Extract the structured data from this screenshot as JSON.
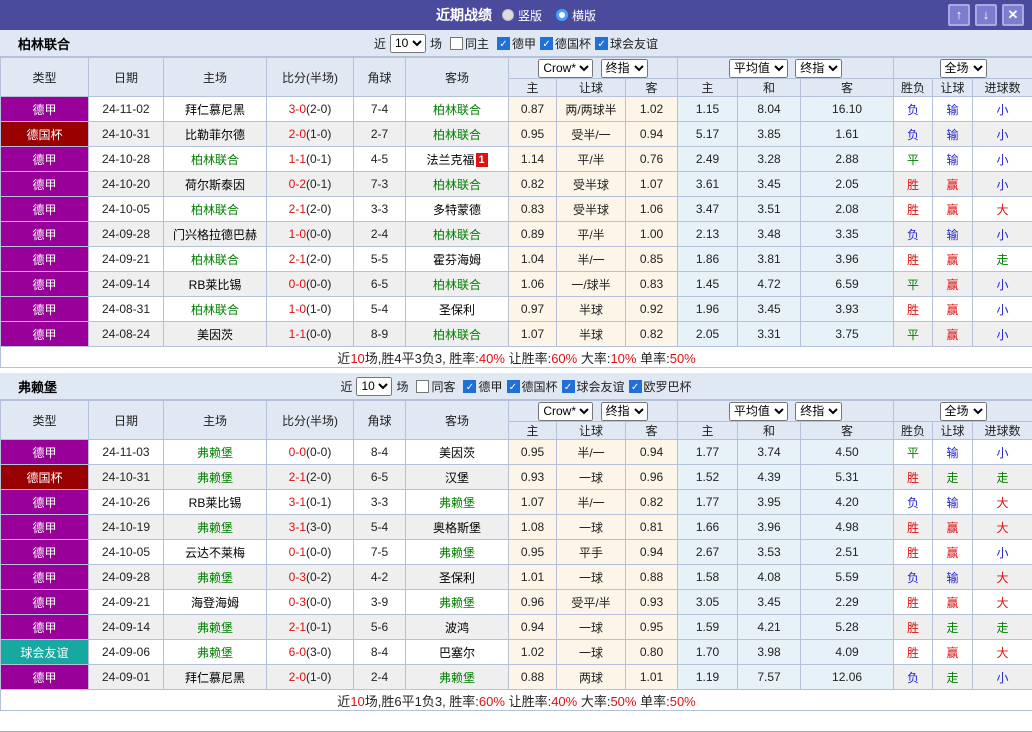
{
  "titlebar": {
    "title": "近期战绩",
    "radios": [
      {
        "label": "竖版",
        "selected": false
      },
      {
        "label": "横版",
        "selected": true
      }
    ],
    "buttons": {
      "up": "↑",
      "down": "↓",
      "close": "✕"
    }
  },
  "table_header": {
    "type": "类型",
    "date": "日期",
    "home": "主场",
    "score": "比分(半场)",
    "corner": "角球",
    "away": "客场",
    "odds_source": "Crow*",
    "odds_time": "终指",
    "avg_source": "平均值",
    "avg_time": "终指",
    "scope": "全场",
    "sub": [
      "主",
      "让球",
      "客",
      "主",
      "和",
      "客",
      "胜负",
      "让球",
      "进球数"
    ]
  },
  "colors": {
    "titlebar_bg": "#4b4b9d",
    "header_bg": "#dfe8f3",
    "border": "#b4c1d8",
    "bundesliga": "#990099",
    "dfb_pokal": "#990000",
    "friendly": "#17a99f",
    "team_green": "#008000",
    "score_red": "#dd1111",
    "result_red": "#dd1111",
    "result_blue": "#2323cb",
    "result_green": "#008000",
    "odds_bg": "#fdf5e8",
    "avg_bg": "#e6f2f8",
    "row_alt_bg": "#efefef"
  },
  "sections": [
    {
      "team": "柏林联合",
      "filter": {
        "near_label": "近",
        "count": "10",
        "matches_label": "场",
        "same": {
          "label": "同主",
          "checked": false
        },
        "comps": [
          {
            "label": "德甲",
            "checked": true
          },
          {
            "label": "德国杯",
            "checked": true
          },
          {
            "label": "球会友谊",
            "checked": true
          }
        ]
      },
      "rows": [
        {
          "comp": "德甲",
          "date": "24-11-02",
          "home": "拜仁慕尼黑",
          "home_green": false,
          "score_ft": "3-0",
          "score_ht": "(2-0)",
          "corner": "7-4",
          "away": "柏林联合",
          "away_green": true,
          "badge": "",
          "odds": [
            "0.87",
            "两/两球半",
            "1.02"
          ],
          "avg": [
            "1.15",
            "8.04",
            "16.10"
          ],
          "results": [
            {
              "t": "负",
              "c": "blue"
            },
            {
              "t": "输",
              "c": "blue"
            },
            {
              "t": "小",
              "c": "blue"
            }
          ]
        },
        {
          "comp": "德国杯",
          "date": "24-10-31",
          "home": "比勒菲尔德",
          "home_green": false,
          "score_ft": "2-0",
          "score_ht": "(1-0)",
          "corner": "2-7",
          "away": "柏林联合",
          "away_green": true,
          "badge": "",
          "odds": [
            "0.95",
            "受半/一",
            "0.94"
          ],
          "avg": [
            "5.17",
            "3.85",
            "1.61"
          ],
          "results": [
            {
              "t": "负",
              "c": "blue"
            },
            {
              "t": "输",
              "c": "blue"
            },
            {
              "t": "小",
              "c": "blue"
            }
          ]
        },
        {
          "comp": "德甲",
          "date": "24-10-28",
          "home": "柏林联合",
          "home_green": true,
          "score_ft": "1-1",
          "score_ht": "(0-1)",
          "corner": "4-5",
          "away": "法兰克福",
          "away_green": false,
          "badge": "1",
          "odds": [
            "1.14",
            "平/半",
            "0.76"
          ],
          "avg": [
            "2.49",
            "3.28",
            "2.88"
          ],
          "results": [
            {
              "t": "平",
              "c": "green"
            },
            {
              "t": "输",
              "c": "blue"
            },
            {
              "t": "小",
              "c": "blue"
            }
          ]
        },
        {
          "comp": "德甲",
          "date": "24-10-20",
          "home": "荷尔斯泰因",
          "home_green": false,
          "score_ft": "0-2",
          "score_ht": "(0-1)",
          "corner": "7-3",
          "away": "柏林联合",
          "away_green": true,
          "badge": "",
          "odds": [
            "0.82",
            "受半球",
            "1.07"
          ],
          "avg": [
            "3.61",
            "3.45",
            "2.05"
          ],
          "results": [
            {
              "t": "胜",
              "c": "red"
            },
            {
              "t": "赢",
              "c": "red"
            },
            {
              "t": "小",
              "c": "blue"
            }
          ]
        },
        {
          "comp": "德甲",
          "date": "24-10-05",
          "home": "柏林联合",
          "home_green": true,
          "score_ft": "2-1",
          "score_ht": "(2-0)",
          "corner": "3-3",
          "away": "多特蒙德",
          "away_green": false,
          "badge": "",
          "odds": [
            "0.83",
            "受半球",
            "1.06"
          ],
          "avg": [
            "3.47",
            "3.51",
            "2.08"
          ],
          "results": [
            {
              "t": "胜",
              "c": "red"
            },
            {
              "t": "赢",
              "c": "red"
            },
            {
              "t": "大",
              "c": "red"
            }
          ]
        },
        {
          "comp": "德甲",
          "date": "24-09-28",
          "home": "门兴格拉德巴赫",
          "home_green": false,
          "score_ft": "1-0",
          "score_ht": "(0-0)",
          "corner": "2-4",
          "away": "柏林联合",
          "away_green": true,
          "badge": "",
          "odds": [
            "0.89",
            "平/半",
            "1.00"
          ],
          "avg": [
            "2.13",
            "3.48",
            "3.35"
          ],
          "results": [
            {
              "t": "负",
              "c": "blue"
            },
            {
              "t": "输",
              "c": "blue"
            },
            {
              "t": "小",
              "c": "blue"
            }
          ]
        },
        {
          "comp": "德甲",
          "date": "24-09-21",
          "home": "柏林联合",
          "home_green": true,
          "score_ft": "2-1",
          "score_ht": "(2-0)",
          "corner": "5-5",
          "away": "霍芬海姆",
          "away_green": false,
          "badge": "",
          "odds": [
            "1.04",
            "半/一",
            "0.85"
          ],
          "avg": [
            "1.86",
            "3.81",
            "3.96"
          ],
          "results": [
            {
              "t": "胜",
              "c": "red"
            },
            {
              "t": "赢",
              "c": "red"
            },
            {
              "t": "走",
              "c": "green"
            }
          ]
        },
        {
          "comp": "德甲",
          "date": "24-09-14",
          "home": "RB莱比锡",
          "home_green": false,
          "score_ft": "0-0",
          "score_ht": "(0-0)",
          "corner": "6-5",
          "away": "柏林联合",
          "away_green": true,
          "badge": "",
          "odds": [
            "1.06",
            "一/球半",
            "0.83"
          ],
          "avg": [
            "1.45",
            "4.72",
            "6.59"
          ],
          "results": [
            {
              "t": "平",
              "c": "green"
            },
            {
              "t": "赢",
              "c": "red"
            },
            {
              "t": "小",
              "c": "blue"
            }
          ]
        },
        {
          "comp": "德甲",
          "date": "24-08-31",
          "home": "柏林联合",
          "home_green": true,
          "score_ft": "1-0",
          "score_ht": "(1-0)",
          "corner": "5-4",
          "away": "圣保利",
          "away_green": false,
          "badge": "",
          "odds": [
            "0.97",
            "半球",
            "0.92"
          ],
          "avg": [
            "1.96",
            "3.45",
            "3.93"
          ],
          "results": [
            {
              "t": "胜",
              "c": "red"
            },
            {
              "t": "赢",
              "c": "red"
            },
            {
              "t": "小",
              "c": "blue"
            }
          ]
        },
        {
          "comp": "德甲",
          "date": "24-08-24",
          "home": "美因茨",
          "home_green": false,
          "score_ft": "1-1",
          "score_ht": "(0-0)",
          "corner": "8-9",
          "away": "柏林联合",
          "away_green": true,
          "badge": "",
          "odds": [
            "1.07",
            "半球",
            "0.82"
          ],
          "avg": [
            "2.05",
            "3.31",
            "3.75"
          ],
          "results": [
            {
              "t": "平",
              "c": "green"
            },
            {
              "t": "赢",
              "c": "red"
            },
            {
              "t": "小",
              "c": "blue"
            }
          ]
        }
      ],
      "summary": [
        {
          "t": "近",
          "c": "k"
        },
        {
          "t": "10",
          "c": "red"
        },
        {
          "t": "场,胜4平3负3, 胜率:",
          "c": "k"
        },
        {
          "t": "40%",
          "c": "red"
        },
        {
          "t": " 让胜率:",
          "c": "k"
        },
        {
          "t": "60%",
          "c": "red"
        },
        {
          "t": " 大率:",
          "c": "k"
        },
        {
          "t": "10%",
          "c": "red"
        },
        {
          "t": " 单率:",
          "c": "k"
        },
        {
          "t": "50%",
          "c": "red"
        }
      ]
    },
    {
      "team": "弗赖堡",
      "filter": {
        "near_label": "近",
        "count": "10",
        "matches_label": "场",
        "same": {
          "label": "同客",
          "checked": false
        },
        "comps": [
          {
            "label": "德甲",
            "checked": true
          },
          {
            "label": "德国杯",
            "checked": true
          },
          {
            "label": "球会友谊",
            "checked": true
          },
          {
            "label": "欧罗巴杯",
            "checked": true
          }
        ]
      },
      "rows": [
        {
          "comp": "德甲",
          "date": "24-11-03",
          "home": "弗赖堡",
          "home_green": true,
          "score_ft": "0-0",
          "score_ht": "(0-0)",
          "corner": "8-4",
          "away": "美因茨",
          "away_green": false,
          "badge": "",
          "odds": [
            "0.95",
            "半/一",
            "0.94"
          ],
          "avg": [
            "1.77",
            "3.74",
            "4.50"
          ],
          "results": [
            {
              "t": "平",
              "c": "green"
            },
            {
              "t": "输",
              "c": "blue"
            },
            {
              "t": "小",
              "c": "blue"
            }
          ]
        },
        {
          "comp": "德国杯",
          "date": "24-10-31",
          "home": "弗赖堡",
          "home_green": true,
          "score_ft": "2-1",
          "score_ht": "(2-0)",
          "corner": "6-5",
          "away": "汉堡",
          "away_green": false,
          "badge": "",
          "odds": [
            "0.93",
            "一球",
            "0.96"
          ],
          "avg": [
            "1.52",
            "4.39",
            "5.31"
          ],
          "results": [
            {
              "t": "胜",
              "c": "red"
            },
            {
              "t": "走",
              "c": "green"
            },
            {
              "t": "走",
              "c": "green"
            }
          ]
        },
        {
          "comp": "德甲",
          "date": "24-10-26",
          "home": "RB莱比锡",
          "home_green": false,
          "score_ft": "3-1",
          "score_ht": "(0-1)",
          "corner": "3-3",
          "away": "弗赖堡",
          "away_green": true,
          "badge": "",
          "odds": [
            "1.07",
            "半/一",
            "0.82"
          ],
          "avg": [
            "1.77",
            "3.95",
            "4.20"
          ],
          "results": [
            {
              "t": "负",
              "c": "blue"
            },
            {
              "t": "输",
              "c": "blue"
            },
            {
              "t": "大",
              "c": "red"
            }
          ]
        },
        {
          "comp": "德甲",
          "date": "24-10-19",
          "home": "弗赖堡",
          "home_green": true,
          "score_ft": "3-1",
          "score_ht": "(3-0)",
          "corner": "5-4",
          "away": "奥格斯堡",
          "away_green": false,
          "badge": "",
          "odds": [
            "1.08",
            "一球",
            "0.81"
          ],
          "avg": [
            "1.66",
            "3.96",
            "4.98"
          ],
          "results": [
            {
              "t": "胜",
              "c": "red"
            },
            {
              "t": "赢",
              "c": "red"
            },
            {
              "t": "大",
              "c": "red"
            }
          ]
        },
        {
          "comp": "德甲",
          "date": "24-10-05",
          "home": "云达不莱梅",
          "home_green": false,
          "score_ft": "0-1",
          "score_ht": "(0-0)",
          "corner": "7-5",
          "away": "弗赖堡",
          "away_green": true,
          "badge": "",
          "odds": [
            "0.95",
            "平手",
            "0.94"
          ],
          "avg": [
            "2.67",
            "3.53",
            "2.51"
          ],
          "results": [
            {
              "t": "胜",
              "c": "red"
            },
            {
              "t": "赢",
              "c": "red"
            },
            {
              "t": "小",
              "c": "blue"
            }
          ]
        },
        {
          "comp": "德甲",
          "date": "24-09-28",
          "home": "弗赖堡",
          "home_green": true,
          "score_ft": "0-3",
          "score_ht": "(0-2)",
          "corner": "4-2",
          "away": "圣保利",
          "away_green": false,
          "badge": "",
          "odds": [
            "1.01",
            "一球",
            "0.88"
          ],
          "avg": [
            "1.58",
            "4.08",
            "5.59"
          ],
          "results": [
            {
              "t": "负",
              "c": "blue"
            },
            {
              "t": "输",
              "c": "blue"
            },
            {
              "t": "大",
              "c": "red"
            }
          ]
        },
        {
          "comp": "德甲",
          "date": "24-09-21",
          "home": "海登海姆",
          "home_green": false,
          "score_ft": "0-3",
          "score_ht": "(0-0)",
          "corner": "3-9",
          "away": "弗赖堡",
          "away_green": true,
          "badge": "",
          "odds": [
            "0.96",
            "受平/半",
            "0.93"
          ],
          "avg": [
            "3.05",
            "3.45",
            "2.29"
          ],
          "results": [
            {
              "t": "胜",
              "c": "red"
            },
            {
              "t": "赢",
              "c": "red"
            },
            {
              "t": "大",
              "c": "red"
            }
          ]
        },
        {
          "comp": "德甲",
          "date": "24-09-14",
          "home": "弗赖堡",
          "home_green": true,
          "score_ft": "2-1",
          "score_ht": "(0-1)",
          "corner": "5-6",
          "away": "波鸿",
          "away_green": false,
          "badge": "",
          "odds": [
            "0.94",
            "一球",
            "0.95"
          ],
          "avg": [
            "1.59",
            "4.21",
            "5.28"
          ],
          "results": [
            {
              "t": "胜",
              "c": "red"
            },
            {
              "t": "走",
              "c": "green"
            },
            {
              "t": "走",
              "c": "green"
            }
          ]
        },
        {
          "comp": "球会友谊",
          "date": "24-09-06",
          "home": "弗赖堡",
          "home_green": true,
          "score_ft": "6-0",
          "score_ht": "(3-0)",
          "corner": "8-4",
          "away": "巴塞尔",
          "away_green": false,
          "badge": "",
          "odds": [
            "1.02",
            "一球",
            "0.80"
          ],
          "avg": [
            "1.70",
            "3.98",
            "4.09"
          ],
          "results": [
            {
              "t": "胜",
              "c": "red"
            },
            {
              "t": "赢",
              "c": "red"
            },
            {
              "t": "大",
              "c": "red"
            }
          ]
        },
        {
          "comp": "德甲",
          "date": "24-09-01",
          "home": "拜仁慕尼黑",
          "home_green": false,
          "score_ft": "2-0",
          "score_ht": "(1-0)",
          "corner": "2-4",
          "away": "弗赖堡",
          "away_green": true,
          "badge": "",
          "odds": [
            "0.88",
            "两球",
            "1.01"
          ],
          "avg": [
            "1.19",
            "7.57",
            "12.06"
          ],
          "results": [
            {
              "t": "负",
              "c": "blue"
            },
            {
              "t": "走",
              "c": "green"
            },
            {
              "t": "小",
              "c": "blue"
            }
          ]
        }
      ],
      "summary": [
        {
          "t": "近",
          "c": "k"
        },
        {
          "t": "10",
          "c": "red"
        },
        {
          "t": "场,胜6平1负3, 胜率:",
          "c": "k"
        },
        {
          "t": "60%",
          "c": "red"
        },
        {
          "t": " 让胜率:",
          "c": "k"
        },
        {
          "t": "40%",
          "c": "red"
        },
        {
          "t": " 大率:",
          "c": "k"
        },
        {
          "t": "50%",
          "c": "red"
        },
        {
          "t": " 单率:",
          "c": "k"
        },
        {
          "t": "50%",
          "c": "red"
        }
      ]
    }
  ]
}
